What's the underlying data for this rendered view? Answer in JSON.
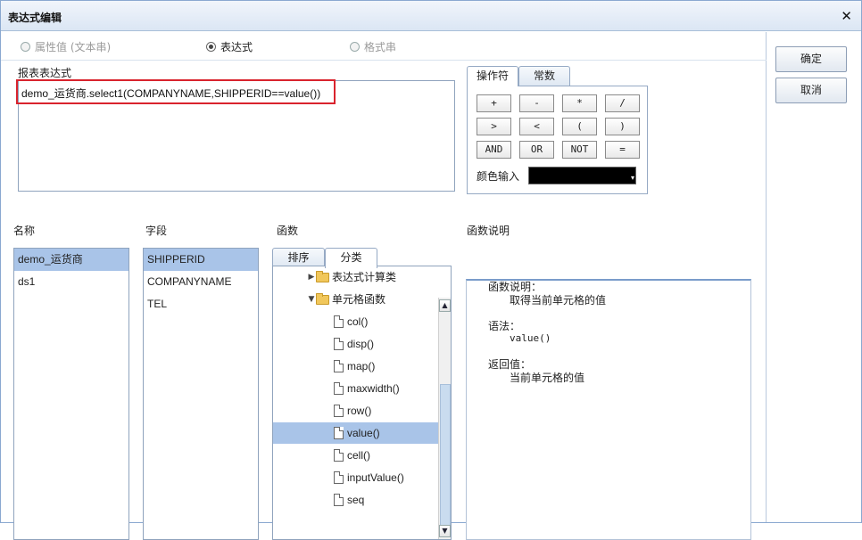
{
  "window": {
    "title": "表达式编辑",
    "close_glyph": "✕"
  },
  "buttons": {
    "ok": "确定",
    "cancel": "取消"
  },
  "mode": {
    "options": [
      {
        "label": "属性值 (文本串)",
        "state": "disabled"
      },
      {
        "label": "表达式",
        "state": "checked"
      },
      {
        "label": "格式串",
        "state": "disabled"
      }
    ]
  },
  "expression": {
    "label": "报表表达式",
    "value": "demo_运货商.select1(COMPANYNAME,SHIPPERID==value())",
    "highlight_color": "#d9232d"
  },
  "operator_tabs": [
    "操作符",
    "常数"
  ],
  "operators": [
    "+",
    "-",
    "*",
    "/",
    ">",
    "<",
    "(",
    ")",
    "AND",
    "OR",
    "NOT",
    "="
  ],
  "color_input": {
    "label": "颜色输入",
    "value_color": "#000000",
    "arrow_glyph": "▾"
  },
  "lists": {
    "name_label": "名称",
    "field_label": "字段",
    "function_label": "函数",
    "description_label": "函数说明",
    "names": [
      "demo_运货商",
      "ds1"
    ],
    "names_selected": 0,
    "fields": [
      "SHIPPERID",
      "COMPANYNAME",
      "TEL"
    ],
    "fields_selected": 0
  },
  "function_tabs": [
    "排序",
    "分类"
  ],
  "function_tree": {
    "categories": [
      "表达式计算类",
      "单元格函数"
    ],
    "functions": [
      "col()",
      "disp()",
      "map()",
      "maxwidth()",
      "row()",
      "value()",
      "cell()",
      "inputValue()",
      "seq"
    ],
    "selected": "value()",
    "arrow_glyph_collapsed": "▶",
    "arrow_glyph_expanded": "▼",
    "scroll_up_glyph": "▲",
    "scroll_down_glyph": "▼"
  },
  "description": {
    "heading": "函数说明：",
    "summary": "取得当前单元格的值",
    "syntax_label": "语法：",
    "syntax": "value()",
    "return_label": "返回值：",
    "return_value": "当前单元格的值"
  },
  "colors": {
    "selection": "#a9c4e8",
    "titlebar": "#dbe6f4",
    "border": "#8fa3bd"
  }
}
